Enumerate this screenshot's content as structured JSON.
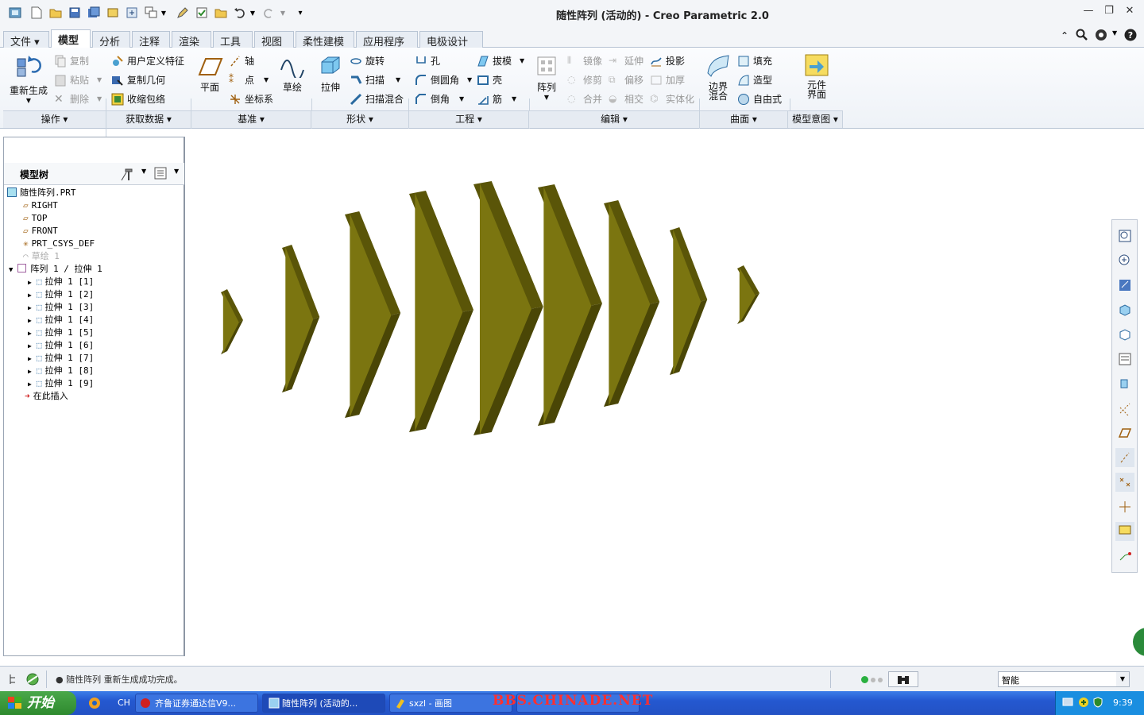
{
  "window": {
    "title": "随性阵列 (活动的) - Creo Parametric 2.0"
  },
  "tabs": [
    "文件 ▾",
    "模型",
    "分析",
    "注释",
    "渲染",
    "工具",
    "视图",
    "柔性建模",
    "应用程序",
    "电极设计"
  ],
  "ribbon": {
    "regenerate": "重新生成",
    "copy": "复制",
    "paste": "粘贴",
    "delete": "删除",
    "udf": "用户定义特征",
    "copy_geom": "复制几何",
    "shrinkwrap": "收缩包络",
    "plane": "平面",
    "axis": "轴",
    "point": "点",
    "csys": "坐标系",
    "sketch": "草绘",
    "extrude": "拉伸",
    "revolve": "旋转",
    "sweep": "扫描",
    "swept_blend": "扫描混合",
    "hole": "孔",
    "round": "倒圆角",
    "chamfer": "倒角",
    "draft": "拔模",
    "shell": "壳",
    "rib": "筋",
    "pattern": "阵列",
    "mirror": "镜像",
    "trim": "修剪",
    "merge": "合并",
    "extend": "延伸",
    "offset": "偏移",
    "intersect": "相交",
    "project": "投影",
    "thicken": "加厚",
    "solidify": "实体化",
    "boundary_blend_1": "边界",
    "boundary_blend_2": "混合",
    "fill": "填充",
    "style": "造型",
    "freestyle": "自由式",
    "component_1": "元件",
    "component_2": "界面"
  },
  "groups": [
    "操作 ▾",
    "获取数据 ▾",
    "基准 ▾",
    "形状 ▾",
    "工程 ▾",
    "编辑 ▾",
    "曲面 ▾",
    "模型意图 ▾"
  ],
  "model_tree": {
    "header": "模型树",
    "root": "随性阵列.PRT",
    "items": [
      "RIGHT",
      "TOP",
      "FRONT",
      "PRT_CSYS_DEF",
      "草绘 1"
    ],
    "pattern": "阵列 1 / 拉伸 1",
    "members": [
      "拉伸 1 [1]",
      "拉伸 1 [2]",
      "拉伸 1 [3]",
      "拉伸 1 [4]",
      "拉伸 1 [5]",
      "拉伸 1 [6]",
      "拉伸 1 [7]",
      "拉伸 1 [8]",
      "拉伸 1 [9]"
    ],
    "insert_here": "在此插入"
  },
  "status": {
    "message": "● 随性阵列 重新生成成功完成。",
    "filter": "智能"
  },
  "taskbar": {
    "start": "开始",
    "lang": "CH",
    "apps": [
      "齐鲁证券通达信V9...",
      "随性阵列 (活动的...",
      "sxzl - 画图"
    ],
    "watermark": "BBS.CHINADE.NET",
    "clock": "9:39"
  },
  "colors": {
    "model_face": "#7b7510",
    "model_side": "#5a5508",
    "accent": "#2458d0"
  }
}
